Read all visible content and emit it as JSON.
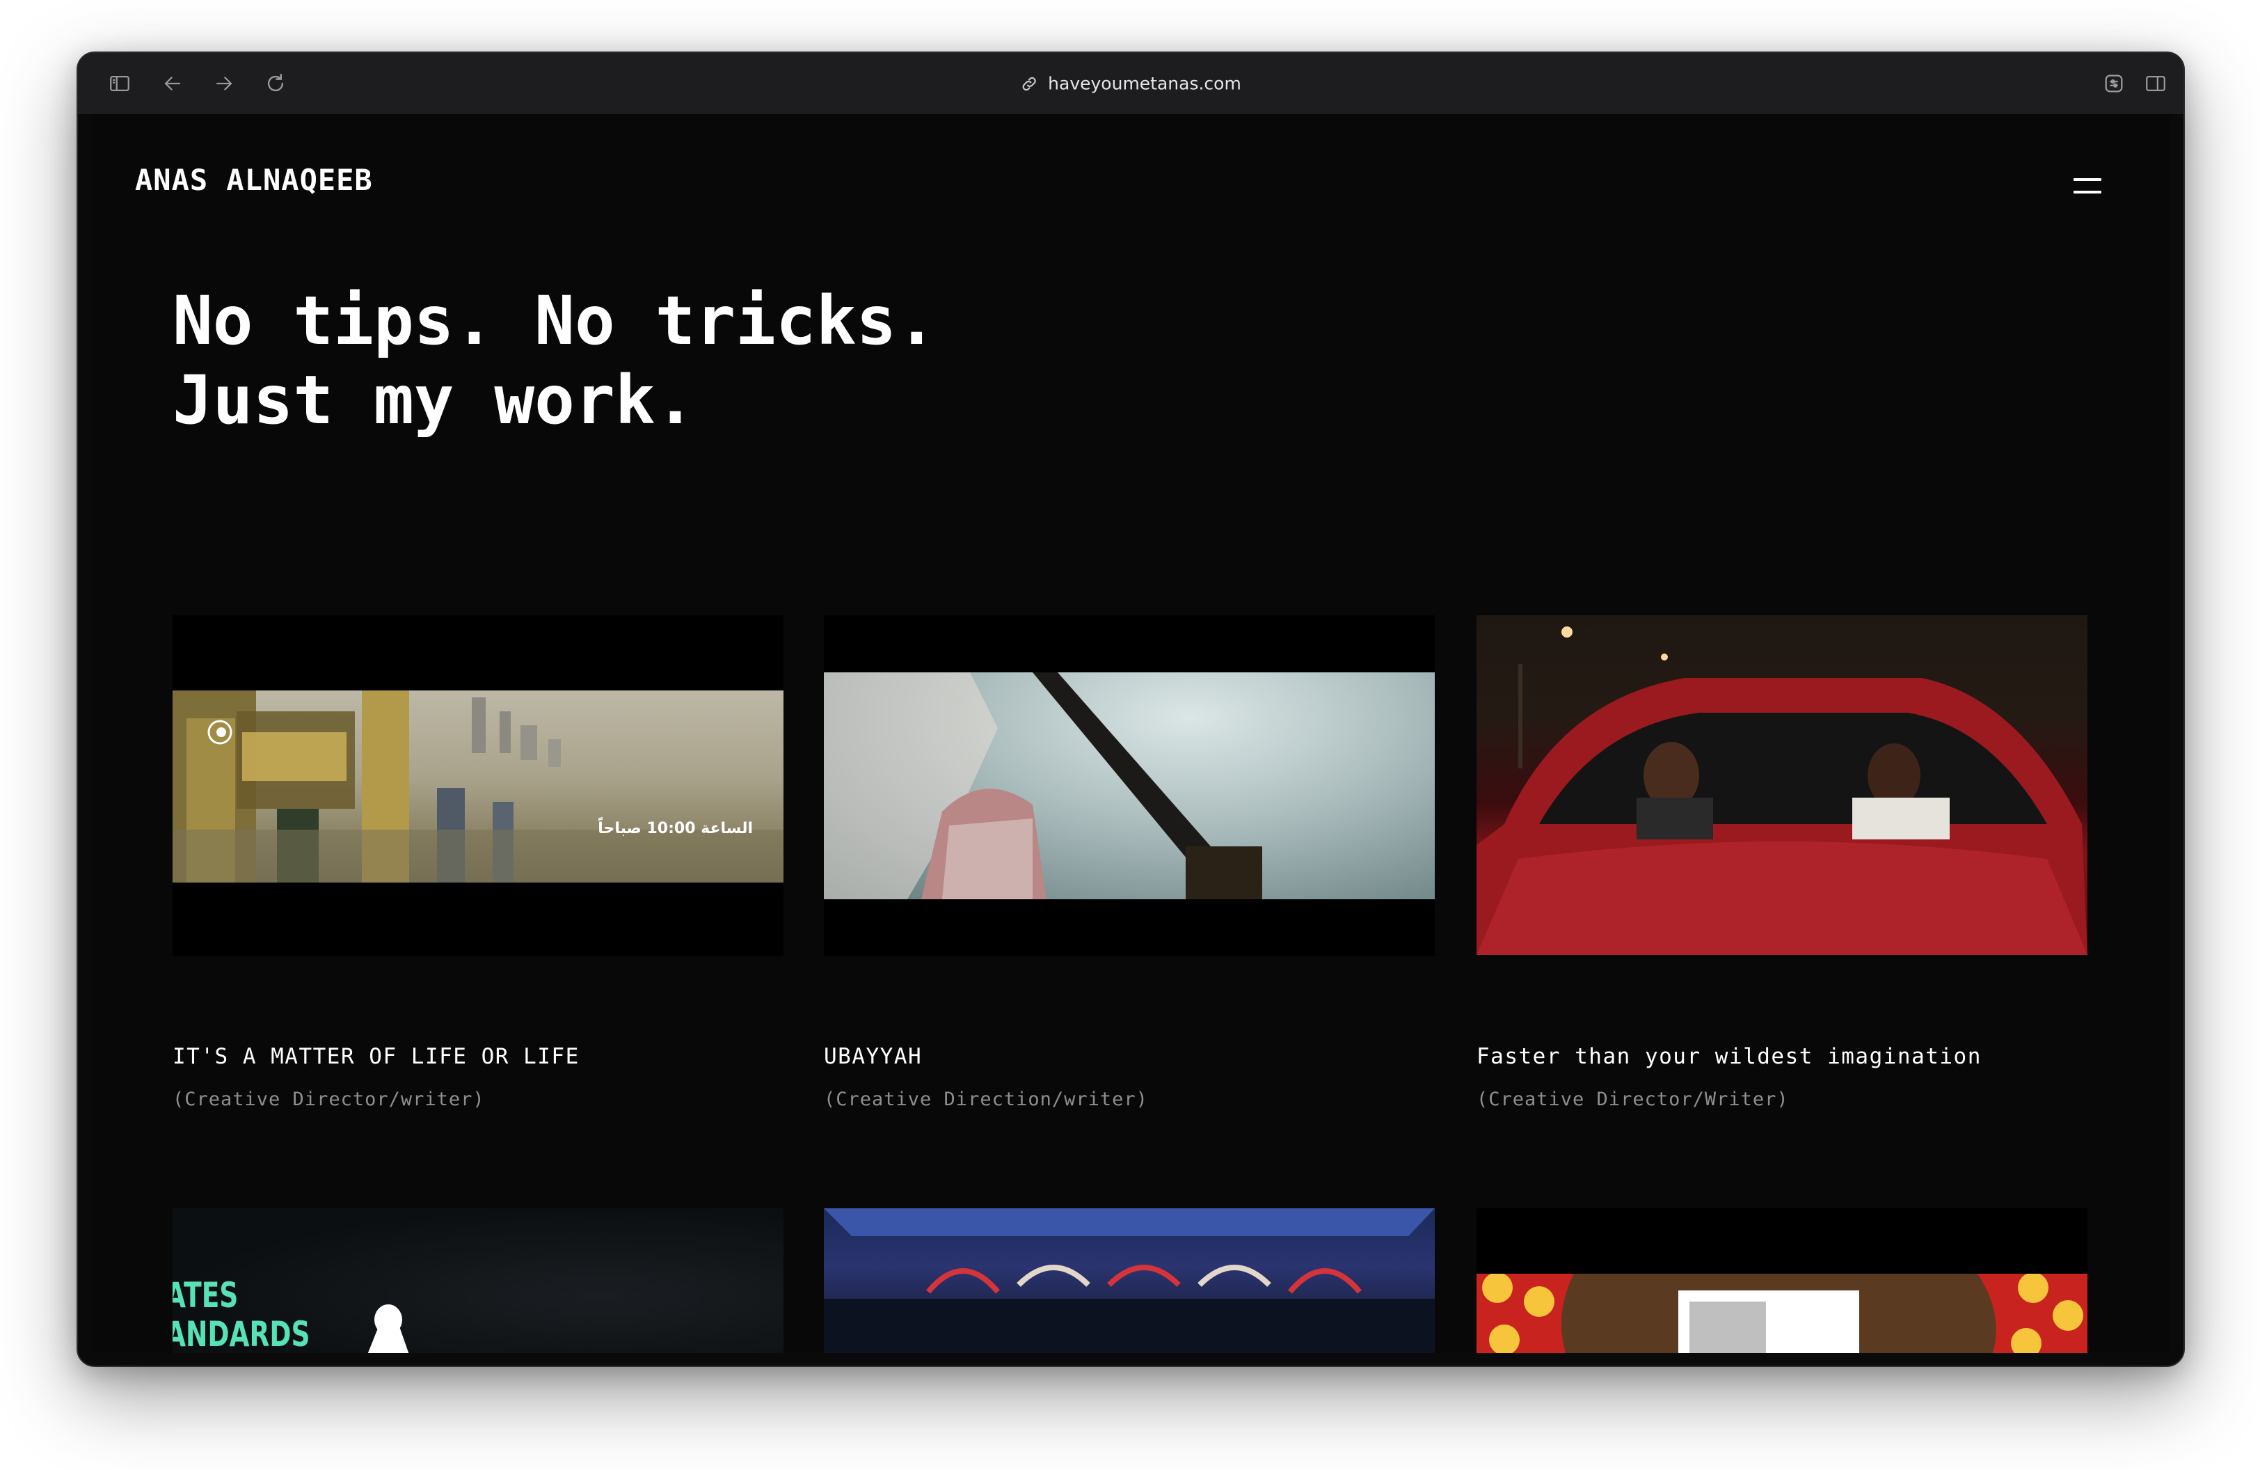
{
  "browser": {
    "url": "haveyoumetanas.com"
  },
  "site": {
    "logo": "ANAS ALNAQEEB",
    "headline_line1": "No tips. No tricks.",
    "headline_line2": "Just my work."
  },
  "projects": [
    {
      "title": "IT'S A MATTER OF LIFE OR LIFE",
      "role": "(Creative Director/writer)",
      "overlay": "الساعة 10:00 صباحاً"
    },
    {
      "title": "UBAYYAH",
      "role": "(Creative Direction/writer)"
    },
    {
      "title": "Faster than your wildest imagination",
      "role": "(Creative Director/Writer)"
    },
    {
      "overlay_line1": "ATES",
      "overlay_line2": "ANDARDS"
    },
    {},
    {}
  ],
  "icons": {
    "sidebar": "sidebar-icon",
    "back": "back-arrow-icon",
    "forward": "forward-arrow-icon",
    "reload": "reload-icon",
    "link": "link-icon",
    "extensions": "extension-icon",
    "split": "split-view-icon",
    "menu": "hamburger-menu-icon"
  },
  "colors": {
    "page_bg": "#080808",
    "toolbar_bg": "#1d1d1f",
    "text": "#ffffff",
    "muted": "#8e8e90"
  }
}
